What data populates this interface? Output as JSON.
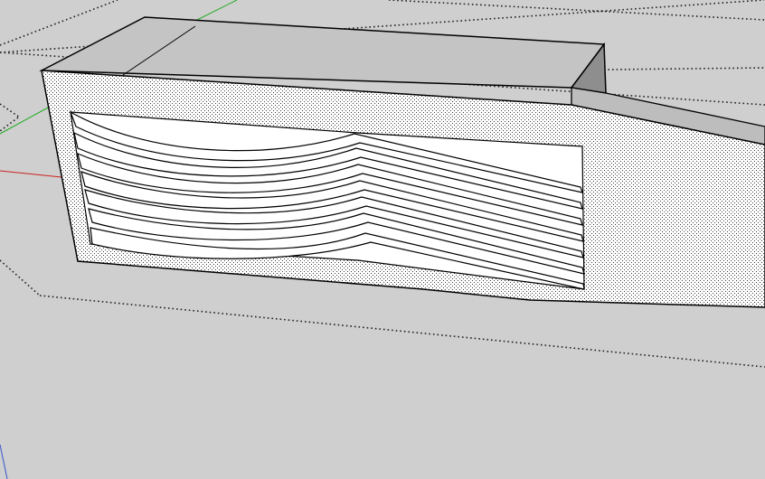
{
  "viewport": {
    "background_color": "#cfcfcf",
    "style": "hidden-line with stipple face texture"
  },
  "axes": {
    "red_axis_color": "#cc2222",
    "green_axis_color": "#22aa22",
    "blue_axis_color": "#3355cc"
  },
  "model": {
    "face_fill_color": "#ffffff",
    "top_face_color": "#c2c2c2",
    "block_top_color": "#b8b8b8",
    "block_side_color": "#a4a4a4",
    "edge_color": "#000000",
    "louver_count": 7
  }
}
